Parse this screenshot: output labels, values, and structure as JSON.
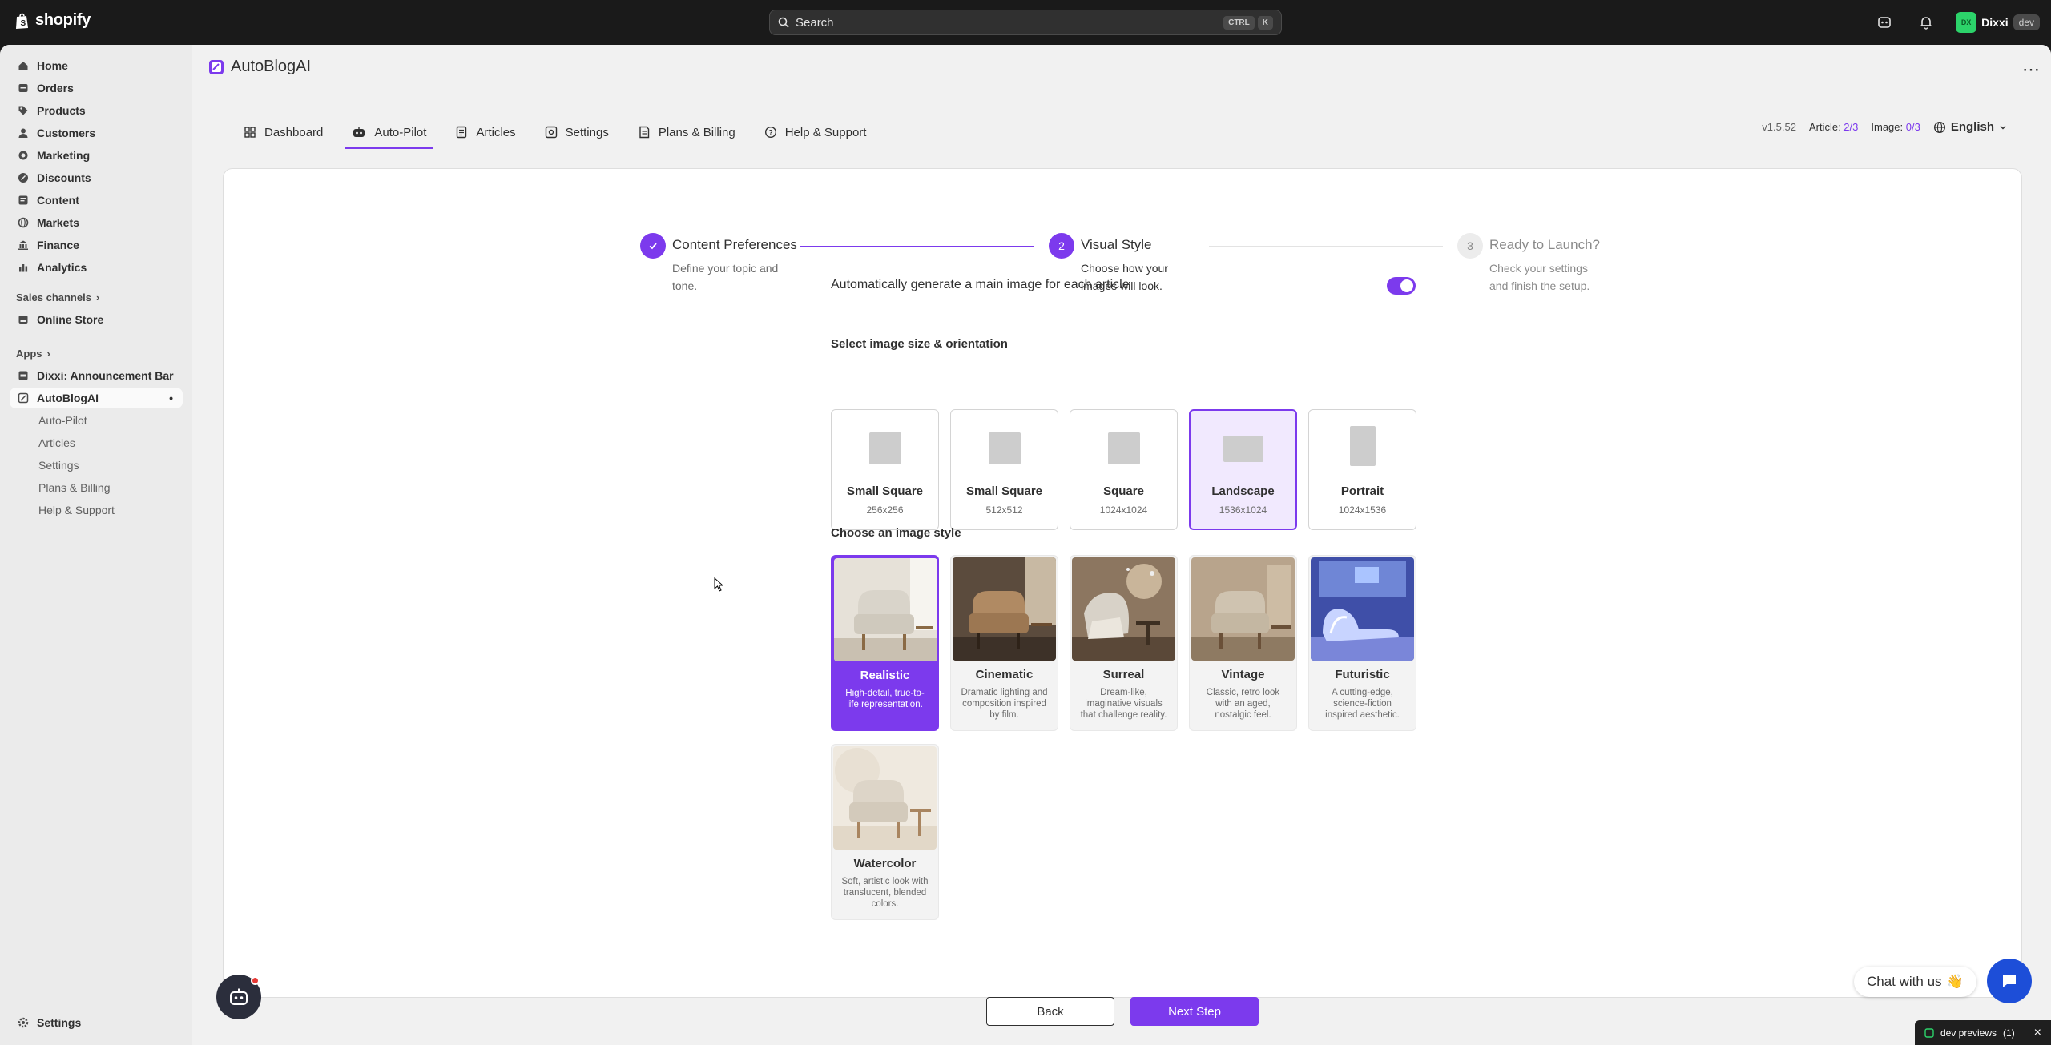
{
  "topbar": {
    "brand": "shopify",
    "search_placeholder": "Search",
    "shortcut_ctrl": "CTRL",
    "shortcut_key": "K",
    "store_initials": "DX",
    "store_name": "Dixxi",
    "store_tag": "dev"
  },
  "sidebar": {
    "items": [
      {
        "label": "Home",
        "icon": "home-icon"
      },
      {
        "label": "Orders",
        "icon": "orders-icon"
      },
      {
        "label": "Products",
        "icon": "tag-icon"
      },
      {
        "label": "Customers",
        "icon": "person-icon"
      },
      {
        "label": "Marketing",
        "icon": "target-icon"
      },
      {
        "label": "Discounts",
        "icon": "discount-icon"
      },
      {
        "label": "Content",
        "icon": "content-icon"
      },
      {
        "label": "Markets",
        "icon": "globe-icon"
      },
      {
        "label": "Finance",
        "icon": "bank-icon"
      },
      {
        "label": "Analytics",
        "icon": "chart-icon"
      }
    ],
    "sales_channels_label": "Sales channels",
    "online_store_label": "Online Store",
    "apps_label": "Apps",
    "app_items": [
      {
        "label": "Dixxi: Announcement Bar"
      },
      {
        "label": "AutoBlogAI"
      }
    ],
    "sub_items": [
      "Auto-Pilot",
      "Articles",
      "Settings",
      "Plans & Billing",
      "Help & Support"
    ],
    "settings_label": "Settings"
  },
  "app": {
    "title": "AutoBlogAI",
    "tabs": [
      {
        "label": "Dashboard",
        "icon": "dashboard-icon"
      },
      {
        "label": "Auto-Pilot",
        "icon": "robot-icon"
      },
      {
        "label": "Articles",
        "icon": "articles-icon"
      },
      {
        "label": "Settings",
        "icon": "settings-icon"
      },
      {
        "label": "Plans & Billing",
        "icon": "billing-icon"
      },
      {
        "label": "Help & Support",
        "icon": "help-icon"
      }
    ],
    "version": "v1.5.52",
    "article_label": "Article:",
    "article_value": "2/3",
    "image_label": "Image:",
    "image_value": "0/3",
    "language": "English"
  },
  "stepper": [
    {
      "number": "",
      "title": "Content Preferences",
      "desc": "Define your topic and tone.",
      "state": "done"
    },
    {
      "number": "2",
      "title": "Visual Style",
      "desc": "Choose how your images will look.",
      "state": "active"
    },
    {
      "number": "3",
      "title": "Ready to Launch?",
      "desc": "Check your settings and finish the setup.",
      "state": "upcoming"
    }
  ],
  "form": {
    "auto_image_label": "Automatically generate a main image for each article",
    "auto_image_enabled": true,
    "size_heading": "Select image size & orientation",
    "sizes": [
      {
        "name": "Small Square",
        "dims": "256x256",
        "selected": false
      },
      {
        "name": "Small Square",
        "dims": "512x512",
        "selected": false
      },
      {
        "name": "Square",
        "dims": "1024x1024",
        "selected": false
      },
      {
        "name": "Landscape",
        "dims": "1536x1024",
        "selected": true
      },
      {
        "name": "Portrait",
        "dims": "1024x1536",
        "selected": false
      }
    ],
    "style_heading": "Choose an image style",
    "styles": [
      {
        "name": "Realistic",
        "desc": "High-detail, true-to-life representation.",
        "selected": true
      },
      {
        "name": "Cinematic",
        "desc": "Dramatic lighting and composition inspired by film.",
        "selected": false
      },
      {
        "name": "Surreal",
        "desc": "Dream-like, imaginative visuals that challenge reality.",
        "selected": false
      },
      {
        "name": "Vintage",
        "desc": "Classic, retro look with an aged, nostalgic feel.",
        "selected": false
      },
      {
        "name": "Futuristic",
        "desc": "A cutting-edge, science-fiction inspired aesthetic.",
        "selected": false
      },
      {
        "name": "Watercolor",
        "desc": "Soft, artistic look with translucent, blended colors.",
        "selected": false
      }
    ],
    "back_label": "Back",
    "next_label": "Next Step"
  },
  "chat": {
    "label": "Chat with us",
    "emoji": "👋"
  },
  "dev_previews": {
    "label": "dev previews",
    "count": "(1)"
  },
  "colors": {
    "accent": "#7c3aed",
    "chat_blue": "#1d4ed8",
    "topbar": "#1a1a1a"
  }
}
